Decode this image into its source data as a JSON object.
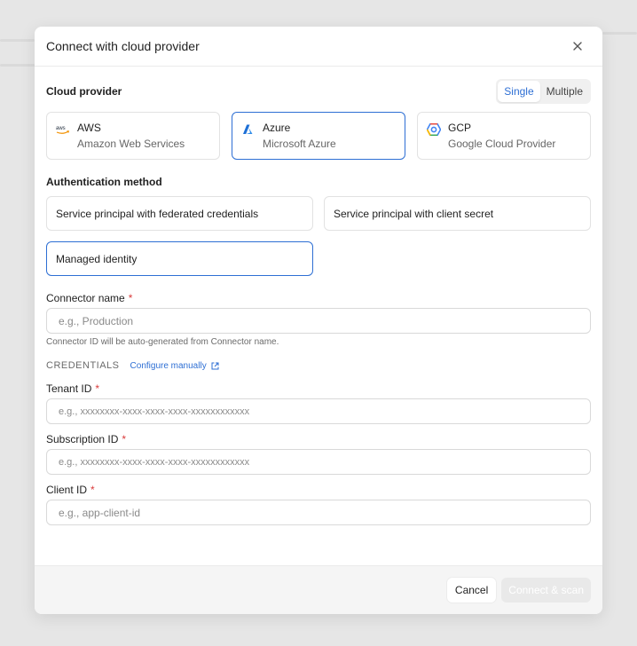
{
  "modal": {
    "title": "Connect with cloud provider",
    "close_icon": "close-icon"
  },
  "provider": {
    "label": "Cloud provider",
    "mode_options": [
      "Single",
      "Multiple"
    ],
    "mode_selected": "Single",
    "options": [
      {
        "name": "AWS",
        "sub": "Amazon Web Services",
        "icon": "aws-logo-icon",
        "selected": false
      },
      {
        "name": "Azure",
        "sub": "Microsoft Azure",
        "icon": "azure-logo-icon",
        "selected": true
      },
      {
        "name": "GCP",
        "sub": "Google Cloud Provider",
        "icon": "gcp-logo-icon",
        "selected": false
      }
    ]
  },
  "auth": {
    "label": "Authentication method",
    "options": [
      {
        "label": "Service principal with federated credentials",
        "selected": false
      },
      {
        "label": "Service principal with client secret",
        "selected": false
      },
      {
        "label": "Managed identity",
        "selected": true
      }
    ]
  },
  "connector": {
    "label": "Connector name",
    "placeholder": "e.g., Production",
    "hint": "Connector ID will be auto-generated from Connector name."
  },
  "credentials": {
    "title": "CREDENTIALS",
    "configure_link": "Configure manually",
    "tenant": {
      "label": "Tenant ID",
      "placeholder": "e.g., xxxxxxxx-xxxx-xxxx-xxxx-xxxxxxxxxxxx"
    },
    "subscription": {
      "label": "Subscription ID",
      "placeholder": "e.g., xxxxxxxx-xxxx-xxxx-xxxx-xxxxxxxxxxxx"
    },
    "client": {
      "label": "Client ID",
      "placeholder": "e.g., app-client-id"
    }
  },
  "footer": {
    "cancel": "Cancel",
    "submit": "Connect & scan"
  },
  "colors": {
    "accent": "#2e6fd4",
    "required": "#d93b3b"
  }
}
